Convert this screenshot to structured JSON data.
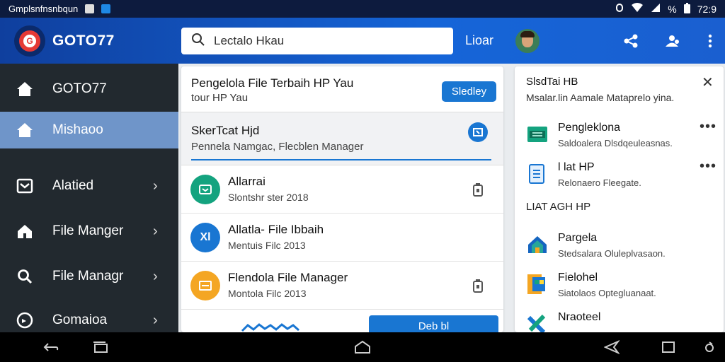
{
  "status_bar": {
    "left_text": "Gmplsnfnsnbqun",
    "time": "72:9",
    "battery_percent": "%",
    "icons": [
      "image-icon",
      "app-icon",
      "alarm-icon",
      "wifi-icon",
      "signal-icon",
      "battery-icon"
    ]
  },
  "app_bar": {
    "title": "GOTO77",
    "search_value": "Lectalo Hkau",
    "link_label": "Lioar",
    "icons": [
      "share-icon",
      "account-switch-icon",
      "more-vert-icon"
    ],
    "brand_color": "#1565d8"
  },
  "sidebar": {
    "items": [
      {
        "label": "GOTO77",
        "icon": "home-icon",
        "active": false
      },
      {
        "label": "Mishaoo",
        "icon": "home-icon",
        "active": true
      },
      {
        "label": "Alatied",
        "icon": "inbox-icon",
        "active": false
      },
      {
        "label": "File Manger",
        "icon": "house-icon",
        "active": false
      },
      {
        "label": "File Managr",
        "icon": "search-icon",
        "active": false
      },
      {
        "label": "Gomaioa",
        "icon": "chat-icon",
        "active": false
      }
    ]
  },
  "main": {
    "title": "Pengelola File Terbaih HP Yau",
    "subtitle": "tour HP Yau",
    "header_button": "Sledley",
    "selected": {
      "title": "SkerTcat Hjd",
      "subtitle": "Pennela Namgac, Flecblen Manager"
    },
    "files": [
      {
        "name": "Allarrai",
        "meta": "Slontshr ster 2018",
        "icon_text": "",
        "color": "#14a37f"
      },
      {
        "name": "Allatla- File Ibbaih",
        "meta": "Mentuis Filc 2013",
        "icon_text": "Xl",
        "color": "#1976d2"
      },
      {
        "name": "Flendola File Manager",
        "meta": "Montola Filc 2013",
        "icon_text": "",
        "color": "#f4a623"
      }
    ],
    "footer_button": "Deb bl"
  },
  "right_panel": {
    "title": "SlsdTai HB",
    "subtitle": "Msalar.lin Aamale Mataprelo yina.",
    "items": [
      {
        "title": "Pengleklona",
        "subtitle": "Saldoalera Dlsdqeuleasnas.",
        "icon": "spreadsheet-icon"
      },
      {
        "title": "l lat HP",
        "subtitle": "Relonaero Fleegate.",
        "icon": "document-icon"
      }
    ],
    "section_title": "LIAT AGH HP",
    "section_items": [
      {
        "title": "Pargela",
        "subtitle": "Stedsalara Oluleplvasaon.",
        "icon": "house-icon"
      },
      {
        "title": "Fielohel",
        "subtitle": "Siatolaos Optegluanaat.",
        "icon": "folder-icon"
      },
      {
        "title": "Nraoteel",
        "subtitle": "",
        "icon": "tools-icon"
      }
    ],
    "close_label": "✕",
    "more_label": "•••"
  },
  "nav_bar": {
    "icons": [
      "back-icon",
      "recents-icon",
      "home-icon",
      "back-arrow-icon",
      "overview-icon",
      "assistant-icon"
    ]
  }
}
